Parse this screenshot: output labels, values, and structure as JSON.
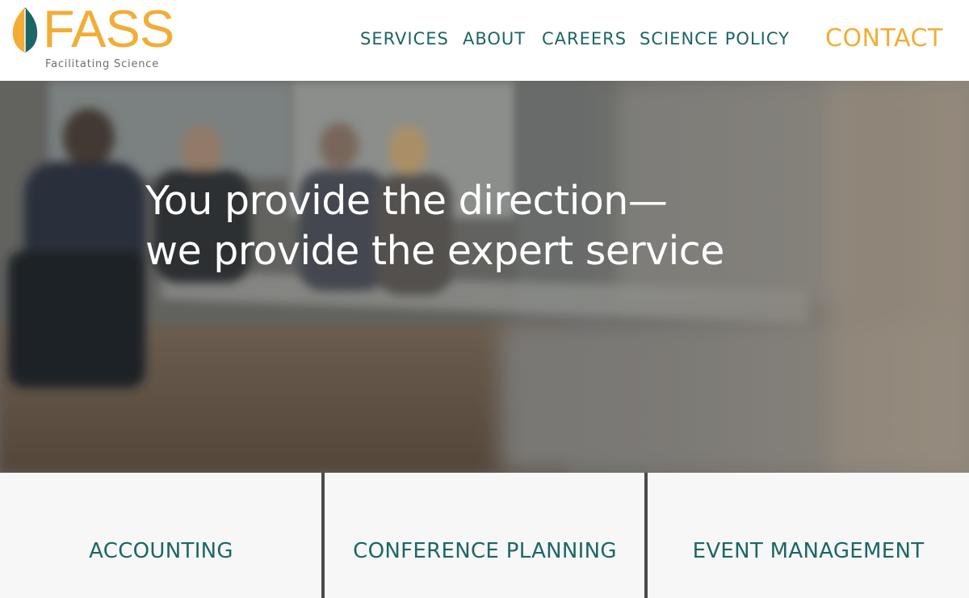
{
  "header": {
    "logo": {
      "name": "FASS",
      "tagline": "Facilitating Science",
      "icon": "leaf-icon",
      "colors": {
        "orange": "#f2ad36",
        "teal": "#1c6665"
      }
    },
    "nav": {
      "items": [
        {
          "label": "SERVICES"
        },
        {
          "label": "ABOUT"
        },
        {
          "label": "CAREERS"
        },
        {
          "label": "SCIENCE POLICY"
        }
      ],
      "contact_label": "CONTACT"
    }
  },
  "hero": {
    "line1": "You provide the direction—",
    "line2": "we provide the expert service"
  },
  "services": {
    "tiles": [
      {
        "label": "ACCOUNTING"
      },
      {
        "label": "CONFERENCE PLANNING"
      },
      {
        "label": "EVENT MANAGEMENT"
      }
    ]
  },
  "theme": {
    "accent_orange": "#f2ad36",
    "accent_teal": "#1c6665",
    "tile_background": "#f7f7f7",
    "divider": "#4a4a4a"
  }
}
